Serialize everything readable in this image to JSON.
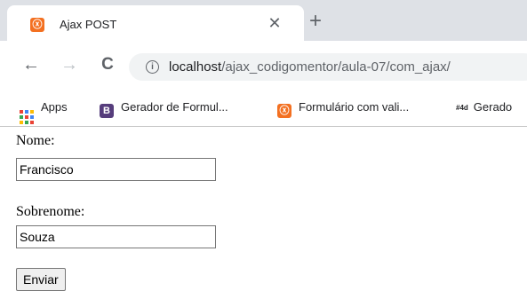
{
  "tab": {
    "title": "Ajax POST",
    "favicon_glyph": "ⓧ",
    "close_glyph": "✕",
    "new_tab_glyph": "+"
  },
  "toolbar": {
    "back_glyph": "←",
    "forward_glyph": "→",
    "reload_glyph": "C",
    "info_glyph": "i",
    "url_host": "localhost",
    "url_path": "/ajax_codigomentor/aula-07/com_ajax/"
  },
  "bookmarks": [
    {
      "label": "Apps",
      "icon": "apps-grid-icon"
    },
    {
      "label": "Gerador de Formul...",
      "icon": "bootstrap-b-icon",
      "glyph": "B",
      "color": "#563d7c"
    },
    {
      "label": "Formulário com vali...",
      "icon": "xampp-icon",
      "glyph": "ⓧ",
      "color": "#f37021"
    },
    {
      "label": "Gerado",
      "icon": "hash-4d-icon",
      "glyph": "#4d"
    }
  ],
  "form": {
    "nome_label": "Nome:",
    "nome_value": "Francisco",
    "sobrenome_label": "Sobrenome:",
    "sobrenome_value": "Souza",
    "submit_label": "Enviar"
  },
  "colors": {
    "tabstrip": "#dee1e6",
    "xampp_orange": "#f37021",
    "bootstrap_purple": "#563d7c"
  }
}
